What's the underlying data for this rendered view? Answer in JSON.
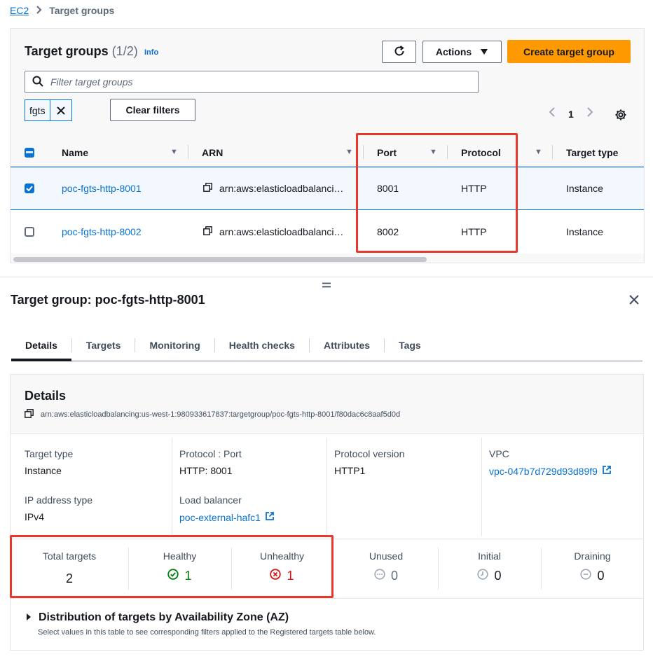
{
  "breadcrumb": {
    "root": "EC2",
    "current": "Target groups"
  },
  "panel": {
    "title": "Target groups",
    "count": "(1/2)",
    "info": "Info",
    "actions_label": "Actions",
    "create_label": "Create target group",
    "filter_placeholder": "Filter target groups",
    "token": "fgts",
    "clear_filters": "Clear filters",
    "page": "1"
  },
  "table": {
    "headers": [
      "Name",
      "ARN",
      "Port",
      "Protocol",
      "Target type"
    ],
    "rows": [
      {
        "name": "poc-fgts-http-8001",
        "arn": "arn:aws:elasticloadbalanci…",
        "port": "8001",
        "protocol": "HTTP",
        "target_type": "Instance",
        "selected": true
      },
      {
        "name": "poc-fgts-http-8002",
        "arn": "arn:aws:elasticloadbalanci…",
        "port": "8002",
        "protocol": "HTTP",
        "target_type": "Instance",
        "selected": false
      }
    ]
  },
  "split": {
    "title": "Target group: poc-fgts-http-8001",
    "tabs": [
      "Details",
      "Targets",
      "Monitoring",
      "Health checks",
      "Attributes",
      "Tags"
    ],
    "active_tab": "Details"
  },
  "details": {
    "title": "Details",
    "arn": "arn:aws:elasticloadbalancing:us-west-1:980933617837:targetgroup/poc-fgts-http-8001/f80dac6c8aaf5d0d",
    "target_type_label": "Target type",
    "target_type": "Instance",
    "protocol_port_label": "Protocol : Port",
    "protocol_port": "HTTP: 8001",
    "protocol_version_label": "Protocol version",
    "protocol_version": "HTTP1",
    "vpc_label": "VPC",
    "vpc": "vpc-047b7d729d93d89f9",
    "ip_type_label": "IP address type",
    "ip_type": "IPv4",
    "lb_label": "Load balancer",
    "lb": "poc-external-hafc1"
  },
  "stats": {
    "total_label": "Total targets",
    "total": "2",
    "healthy_label": "Healthy",
    "healthy": "1",
    "unhealthy_label": "Unhealthy",
    "unhealthy": "1",
    "unused_label": "Unused",
    "unused": "0",
    "initial_label": "Initial",
    "initial": "0",
    "draining_label": "Draining",
    "draining": "0"
  },
  "distribution": {
    "title": "Distribution of targets by Availability Zone (AZ)",
    "subtitle": "Select values in this table to see corresponding filters applied to the Registered targets table below."
  },
  "colors": {
    "accent": "#0972d3",
    "primary_button": "#ff9900",
    "highlight": "#e8372d",
    "healthy": "#037f0c",
    "unhealthy": "#d91515"
  }
}
